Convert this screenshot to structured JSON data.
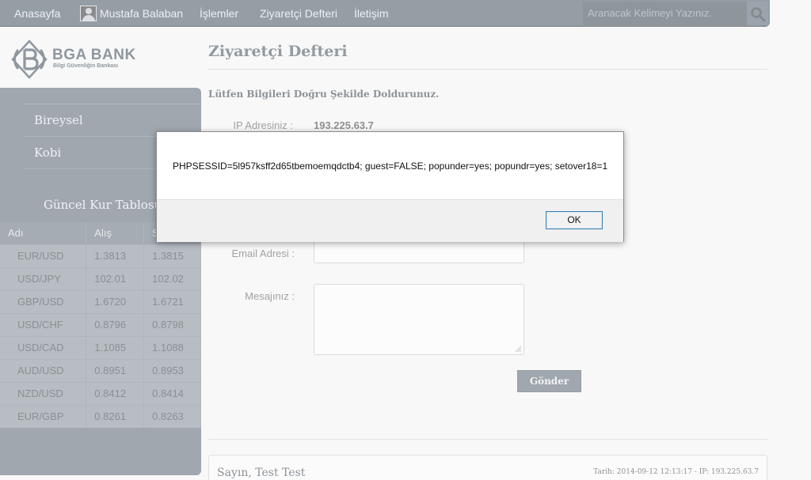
{
  "nav": {
    "home": "Anasayfa",
    "user": "Mustafa Balaban",
    "operations": "İşlemler",
    "guestbook": "Ziyaretçi Defteri",
    "contact": "İletişim",
    "search_placeholder": "Aranacak Kelimeyi Yazınız."
  },
  "logo": {
    "name": "BGA BANK",
    "slogan": "Bilgi Güvenliğin Bankası"
  },
  "sidebar": {
    "items": [
      "Bireysel",
      "Kobi"
    ],
    "rates_title": "Güncel Kur Tablosu",
    "rates_headers": [
      "Adı",
      "Alış",
      "Satış"
    ],
    "rates": [
      {
        "pair": "EUR/USD",
        "buy": "1.3813",
        "sell": "1.3815"
      },
      {
        "pair": "USD/JPY",
        "buy": "102.01",
        "sell": "102.02"
      },
      {
        "pair": "GBP/USD",
        "buy": "1.6720",
        "sell": "1.6721"
      },
      {
        "pair": "USD/CHF",
        "buy": "0.8796",
        "sell": "0.8798"
      },
      {
        "pair": "USD/CAD",
        "buy": "1.1085",
        "sell": "1.1088"
      },
      {
        "pair": "AUD/USD",
        "buy": "0.8951",
        "sell": "0.8953"
      },
      {
        "pair": "NZD/USD",
        "buy": "0.8412",
        "sell": "0.8414"
      },
      {
        "pair": "EUR/GBP",
        "buy": "0.8261",
        "sell": "0.8263"
      }
    ]
  },
  "main": {
    "title": "Ziyaretçi Defteri",
    "subtitle": "Lütfen Bilgileri Doğru Şekilde Doldurunuz.",
    "ip_label": "IP Adresiniz :",
    "ip_value": "193.225.63.7",
    "email_label": "Email Adresi :",
    "message_label": "Mesajınız :",
    "submit": "Gönder",
    "entry": {
      "name": "Sayın, Test Test",
      "meta": "Tarih: 2014-09-12 12:13:17 - IP: 193.225.63.7"
    }
  },
  "dialog": {
    "message": "PHPSESSID=5l957ksff2d65tbemoemqdctb4; guest=FALSE; popunder=yes; popundr=yes; setover18=1",
    "ok": "OK"
  },
  "colors": {
    "nav_bg": "#3e4e5c",
    "sidebar_bg": "#52606c",
    "page_bg": "#f2f2f2"
  }
}
